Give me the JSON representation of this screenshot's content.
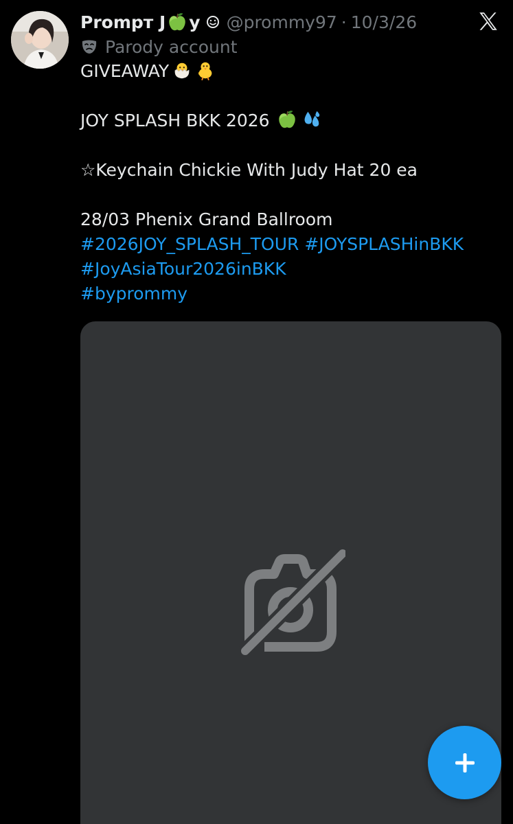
{
  "tweet": {
    "display_name_prefix": "Prompт J",
    "display_name_suffix": "y",
    "handle": "@prommy97",
    "separator": "·",
    "date": "10/3/26",
    "parody_label": "Parody account",
    "lines": {
      "giveaway": "GIVEAWAY",
      "event": "JOY SPLASH BKK 2026",
      "item": "☆Keychain Chickie With Judy Hat 20 ea",
      "venue": "28/03 Phenix Grand Ballroom",
      "hashtag_1": "#2026JOY_SPLASH_TOUR",
      "hashtag_2": "#JOYSPLASHinBKK",
      "hashtag_3": "#JoyAsiaTour2026inBKK",
      "hashtag_4": "#byprommy"
    }
  },
  "icons": {
    "avatar": "profile-photo",
    "name_emoji": "green-apple-emoji",
    "name_badge": "smiley-icon",
    "brand": "x-logo-icon",
    "parody": "theater-mask-icon",
    "giveaway_emojis": [
      "hatching-chick-emoji",
      "baby-chick-emoji"
    ],
    "event_emojis": [
      "green-apple-emoji",
      "sweat-droplets-emoji"
    ],
    "media_placeholder": "no-camera-icon",
    "fab": "plus-icon"
  },
  "colors": {
    "background": "#000000",
    "text_primary": "#e7e9ea",
    "text_secondary": "#71767b",
    "link": "#1d9bf0",
    "media_card": "#323436",
    "fab": "#1d9bf0"
  }
}
